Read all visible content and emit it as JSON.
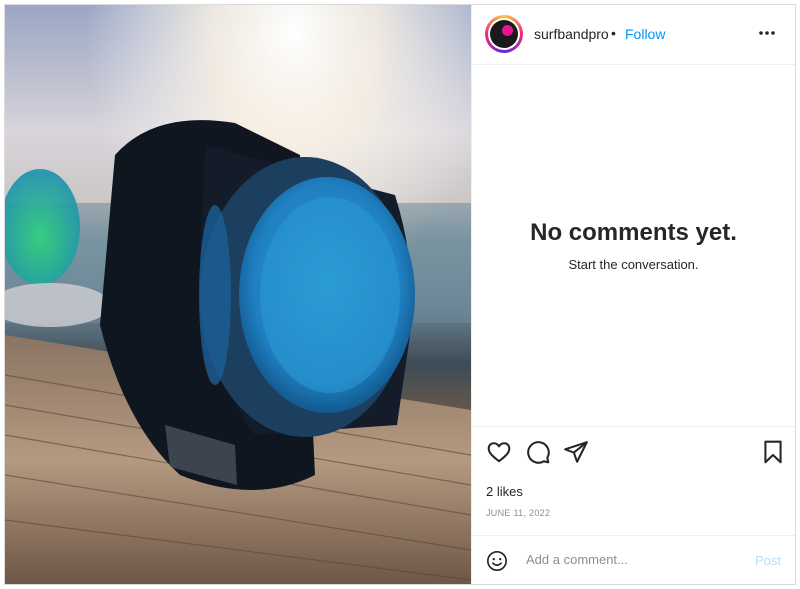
{
  "post": {
    "username": "surfbandpro",
    "separator": "•",
    "follow_label": "Follow",
    "empty_title": "No comments yet.",
    "empty_subtitle": "Start the conversation.",
    "likes": "2 likes",
    "date": "JUNE 11, 2022",
    "comment_placeholder": "Add a comment...",
    "post_label": "Post"
  },
  "icons": {
    "more": "more-options-icon",
    "like": "heart-icon",
    "comment": "comment-icon",
    "share": "send-icon",
    "save": "bookmark-icon",
    "emoji": "emoji-icon",
    "avatar": "avatar"
  },
  "colors": {
    "accent": "#0095f6",
    "post_disabled": "#b2dffc",
    "text": "#262626",
    "muted": "#8e8e8e",
    "border": "#dbdbdb"
  }
}
